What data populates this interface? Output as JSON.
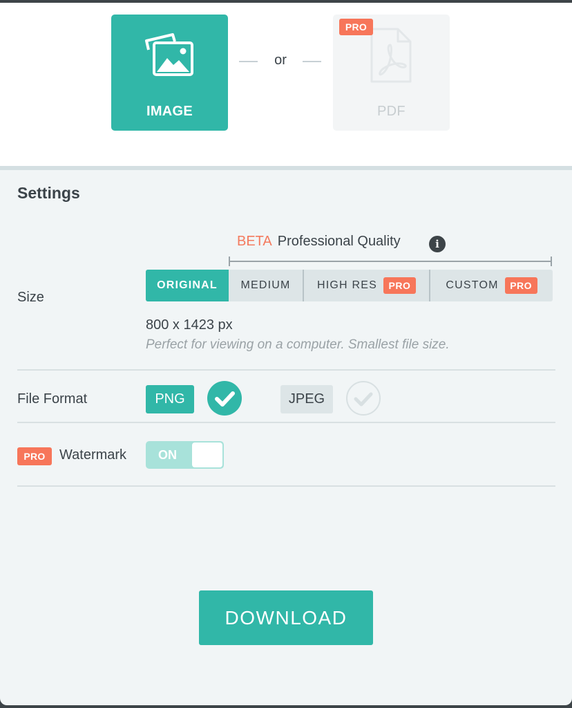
{
  "export_type": {
    "image": {
      "label": "IMAGE",
      "selected": true,
      "icon": "image-icon"
    },
    "separator": "or",
    "pdf": {
      "label": "PDF",
      "badge": "PRO",
      "selected": false,
      "icon": "pdf-file-icon"
    }
  },
  "settings": {
    "title": "Settings",
    "quality_beta": "BETA",
    "quality_label": "Professional Quality",
    "info_icon": "i",
    "size": {
      "label": "Size",
      "options": [
        {
          "label": "ORIGINAL",
          "selected": true
        },
        {
          "label": "MEDIUM"
        },
        {
          "label": "HIGH RES",
          "badge": "PRO"
        },
        {
          "label": "CUSTOM",
          "badge": "PRO"
        }
      ],
      "dimensions": "800 x 1423 px",
      "description": "Perfect for viewing on a computer. Smallest file size."
    },
    "file_format": {
      "label": "File Format",
      "options": [
        {
          "label": "PNG",
          "selected": true
        },
        {
          "label": "JPEG",
          "selected": false
        }
      ]
    },
    "watermark": {
      "badge": "PRO",
      "label": "Watermark",
      "toggle": "ON"
    }
  },
  "download_label": "DOWNLOAD",
  "colors": {
    "accent": "#31b7a8",
    "pro_badge": "#f7765a",
    "beta": "#f47a5e",
    "background": "#f1f5f6"
  }
}
